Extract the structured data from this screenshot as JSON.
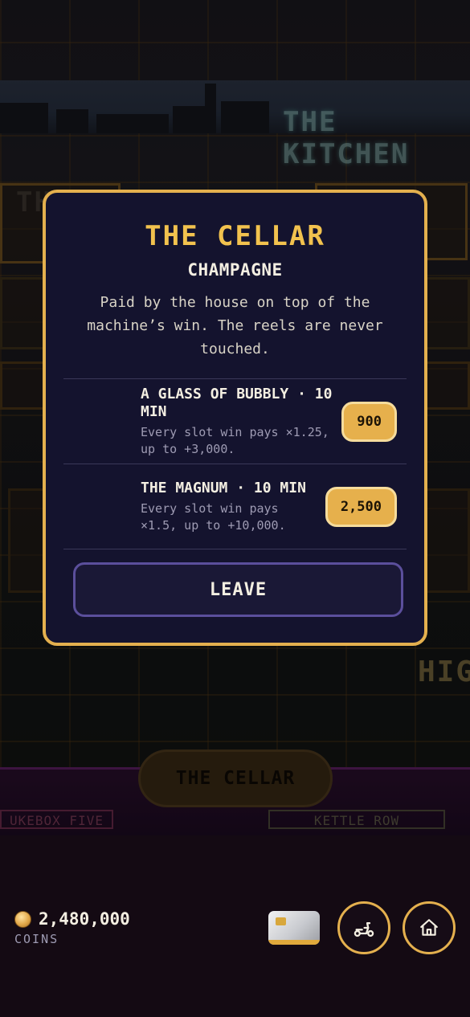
{
  "background": {
    "signs": {
      "kitchen": "THE KITCHEN",
      "high": "HIG",
      "the": "TH"
    },
    "place_button_label": "THE CELLAR",
    "neon_labels": [
      "UKEBOX FIVE",
      "KETTLE ROW"
    ]
  },
  "modal": {
    "title": "THE CELLAR",
    "subtitle": "CHAMPAGNE",
    "description": "Paid by the house on top of the machine’s win. The reels are never touched.",
    "offers": [
      {
        "name": "A GLASS OF BUBBLY · 10 MIN",
        "detail": "Every slot win pays ×1.25, up to +3,000.",
        "price": "900"
      },
      {
        "name": "THE MAGNUM · 10 MIN",
        "detail": "Every slot win pays ×1.5, up to +10,000.",
        "price": "2,500"
      }
    ],
    "leave_label": "LEAVE"
  },
  "bottom_bar": {
    "coins": "2,480,000",
    "coins_label": "COINS",
    "icons": [
      "coin-icon",
      "card-icon",
      "scooter-icon",
      "home-icon"
    ]
  },
  "colors": {
    "accent_gold": "#e4b04e",
    "title_gold": "#f2c24e",
    "modal_bg": "#14132e",
    "leave_border": "#5b4f9c"
  }
}
